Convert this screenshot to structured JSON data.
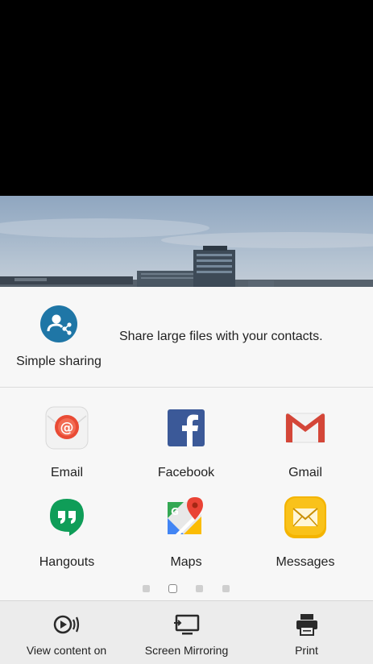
{
  "simple_sharing": {
    "label": "Simple sharing",
    "description": "Share large files with your contacts.",
    "icon": "simple-sharing-icon"
  },
  "apps": [
    {
      "label": "Email",
      "icon": "email-icon"
    },
    {
      "label": "Facebook",
      "icon": "facebook-icon"
    },
    {
      "label": "Gmail",
      "icon": "gmail-icon"
    },
    {
      "label": "Hangouts",
      "icon": "hangouts-icon"
    },
    {
      "label": "Maps",
      "icon": "maps-icon"
    },
    {
      "label": "Messages",
      "icon": "messages-icon"
    }
  ],
  "pagination": {
    "pages": 4,
    "current": 2
  },
  "bottom_actions": [
    {
      "label": "View content on",
      "icon": "cast-icon"
    },
    {
      "label": "Screen Mirroring",
      "icon": "screen-mirroring-icon"
    },
    {
      "label": "Print",
      "icon": "printer-icon"
    }
  ],
  "colors": {
    "simple_sharing_blue": "#1f76a6",
    "facebook_blue": "#3b5998",
    "gmail_red": "#d44638",
    "hangouts_green": "#0f9d58",
    "messages_yellow": "#f4b400"
  }
}
